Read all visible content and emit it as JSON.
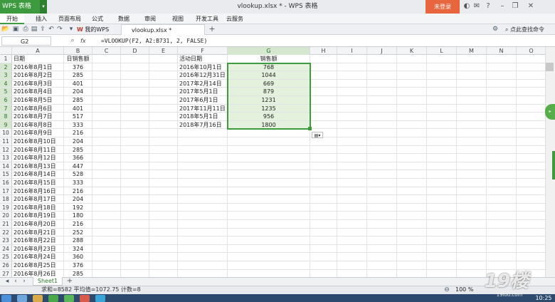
{
  "app": {
    "brand": "WPS 表格",
    "title": "vlookup.xlsx * - WPS 表格",
    "login": "未登录"
  },
  "menu": [
    "开始",
    "插入",
    "页面布局",
    "公式",
    "数据",
    "审阅",
    "视图",
    "开发工具",
    "云服务"
  ],
  "tabs": {
    "mywps": "我的WPS",
    "file": "vlookup.xlsx *",
    "add": "+"
  },
  "search_cmd": "点此查找命令",
  "formula_bar": {
    "cell_ref": "G2",
    "fx": "fx",
    "formula": "=VLOOKUP(F2, A2:B731, 2, FALSE)"
  },
  "columns": [
    "A",
    "B",
    "C",
    "D",
    "E",
    "F",
    "G",
    "H",
    "I",
    "J",
    "K",
    "L",
    "M",
    "N",
    "O"
  ],
  "selected_column": "G",
  "rows": [
    "1",
    "2",
    "3",
    "4",
    "5",
    "6",
    "7",
    "8",
    "9",
    "10",
    "11",
    "12",
    "13",
    "14",
    "15",
    "16",
    "17",
    "18",
    "19",
    "20",
    "21",
    "22",
    "23",
    "24",
    "25",
    "26",
    "27"
  ],
  "colA": [
    "日期",
    "2016年8月1日",
    "2016年8月2日",
    "2016年8月3日",
    "2016年8月4日",
    "2016年8月5日",
    "2016年8月6日",
    "2016年8月7日",
    "2016年8月8日",
    "2016年8月9日",
    "2016年8月10日",
    "2016年8月11日",
    "2016年8月12日",
    "2016年8月13日",
    "2016年8月14日",
    "2016年8月15日",
    "2016年8月16日",
    "2016年8月17日",
    "2016年8月18日",
    "2016年8月19日",
    "2016年8月20日",
    "2016年8月21日",
    "2016年8月22日",
    "2016年8月23日",
    "2016年8月24日",
    "2016年8月25日",
    "2016年8月26日"
  ],
  "colB": [
    "日销售额",
    "376",
    "285",
    "401",
    "204",
    "285",
    "401",
    "517",
    "333",
    "216",
    "204",
    "285",
    "366",
    "447",
    "528",
    "333",
    "216",
    "204",
    "192",
    "180",
    "216",
    "252",
    "288",
    "324",
    "360",
    "376",
    "285"
  ],
  "colF": [
    "活动日期",
    "2016年10月1日",
    "2016年12月31日",
    "2017年2月14日",
    "2017年5月1日",
    "2017年6月1日",
    "2017年11月11日",
    "2018年5月1日",
    "2018年7月16日"
  ],
  "colG": [
    "销售额",
    "768",
    "1044",
    "669",
    "879",
    "1231",
    "1235",
    "956",
    "1800"
  ],
  "sheet": {
    "name": "Sheet1",
    "add": "+"
  },
  "status": {
    "stats": "求和=8582  平均值=1072.75  计数=8",
    "zoom": "100 %"
  },
  "clock": "10:25",
  "watermark": {
    "main": "19楼",
    "sub": "19lou.com"
  },
  "colors": {
    "accent": "#3d9a3f",
    "selection": "#e3f1dd",
    "login": "#e8663e"
  }
}
